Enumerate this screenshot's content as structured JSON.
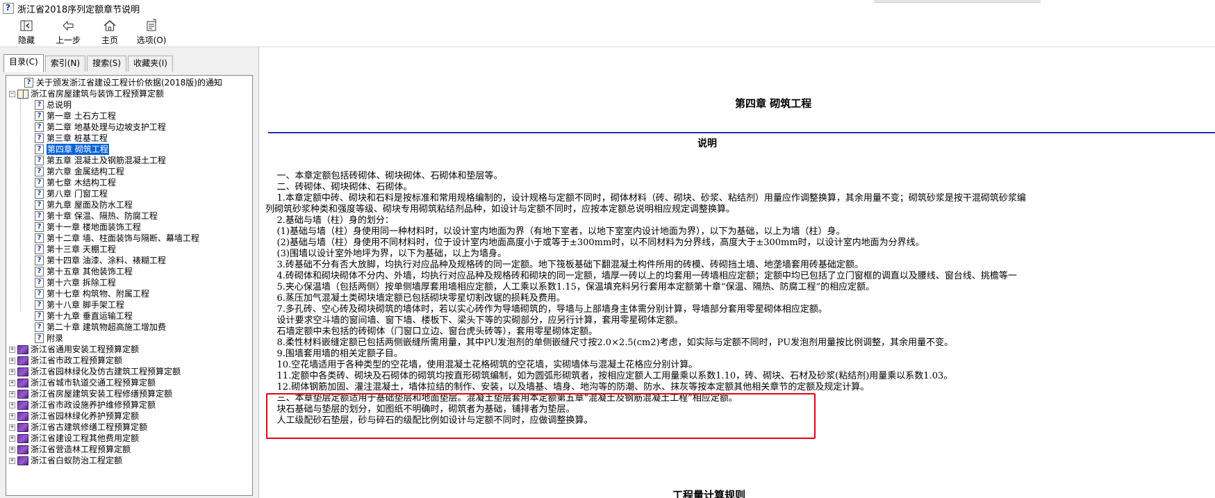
{
  "window": {
    "title": "浙江省2018序列定额章节说明"
  },
  "toolbar": {
    "hide": "隐藏",
    "back": "上一步",
    "home": "主页",
    "options": "选项(O)"
  },
  "tabs": [
    "目录(C)",
    "索引(N)",
    "搜索(S)",
    "收藏夹(I)"
  ],
  "tree": {
    "items": [
      {
        "label": "关于颁发浙江省建设工程计价依据(2018版)的通知",
        "level": 1,
        "icon": "question-icon"
      },
      {
        "label": "浙江省房屋建筑与装饰工程预算定额",
        "level": 0,
        "icon": "open-book-icon",
        "expander": "−"
      },
      {
        "label": "总说明",
        "level": 2,
        "icon": "question-icon"
      },
      {
        "label": "第一章 土石方工程",
        "level": 2,
        "icon": "question-icon"
      },
      {
        "label": "第二章 地基处理与边坡支护工程",
        "level": 2,
        "icon": "question-icon"
      },
      {
        "label": "第三章 桩基工程",
        "level": 2,
        "icon": "question-icon"
      },
      {
        "label": "第四章 砌筑工程",
        "level": 2,
        "icon": "question-icon",
        "selected": true
      },
      {
        "label": "第五章 混凝土及钢筋混凝土工程",
        "level": 2,
        "icon": "question-icon"
      },
      {
        "label": "第六章 金属结构工程",
        "level": 2,
        "icon": "question-icon"
      },
      {
        "label": "第七章 木结构工程",
        "level": 2,
        "icon": "question-icon"
      },
      {
        "label": "第八章 门窗工程",
        "level": 2,
        "icon": "question-icon"
      },
      {
        "label": "第九章 屋面及防水工程",
        "level": 2,
        "icon": "question-icon"
      },
      {
        "label": "第十章 保温、隔热、防腐工程",
        "level": 2,
        "icon": "question-icon"
      },
      {
        "label": "第十一章 楼地面装饰工程",
        "level": 2,
        "icon": "question-icon"
      },
      {
        "label": "第十二章 墙、柱面装饰与隔断、幕墙工程",
        "level": 2,
        "icon": "question-icon"
      },
      {
        "label": "第十三章 天棚工程",
        "level": 2,
        "icon": "question-icon"
      },
      {
        "label": "第十四章 油漆、涂料、裱糊工程",
        "level": 2,
        "icon": "question-icon"
      },
      {
        "label": "第十五章 其他装饰工程",
        "level": 2,
        "icon": "question-icon"
      },
      {
        "label": "第十六章 拆除工程",
        "level": 2,
        "icon": "question-icon"
      },
      {
        "label": "第十七章 构筑物、附属工程",
        "level": 2,
        "icon": "question-icon"
      },
      {
        "label": "第十八章 脚手架工程",
        "level": 2,
        "icon": "question-icon"
      },
      {
        "label": "第十九章 垂直运输工程",
        "level": 2,
        "icon": "question-icon"
      },
      {
        "label": "第二十章 建筑物超高施工增加费",
        "level": 2,
        "icon": "question-icon"
      },
      {
        "label": "附录",
        "level": 2,
        "icon": "question-icon"
      },
      {
        "label": "浙江省通用安装工程预算定额",
        "level": 0,
        "icon": "closed-book-icon",
        "expander": "+"
      },
      {
        "label": "浙江省市政工程预算定额",
        "level": 0,
        "icon": "closed-book-icon",
        "expander": "+"
      },
      {
        "label": "浙江省园林绿化及仿古建筑工程预算定额",
        "level": 0,
        "icon": "closed-book-icon",
        "expander": "+"
      },
      {
        "label": "浙江省城市轨道交通工程预算定额",
        "level": 0,
        "icon": "closed-book-icon",
        "expander": "+"
      },
      {
        "label": "浙江省房屋建筑安装工程修缮预算定额",
        "level": 0,
        "icon": "closed-book-icon",
        "expander": "+"
      },
      {
        "label": "浙江省市政设施养护维修预算定额",
        "level": 0,
        "icon": "closed-book-icon",
        "expander": "+"
      },
      {
        "label": "浙江省园林绿化养护预算定额",
        "level": 0,
        "icon": "closed-book-icon",
        "expander": "+"
      },
      {
        "label": "浙江省古建筑修缮工程预算定额",
        "level": 0,
        "icon": "closed-book-icon",
        "expander": "+"
      },
      {
        "label": "浙江省建设工程其他费用定额",
        "level": 0,
        "icon": "closed-book-icon",
        "expander": "+"
      },
      {
        "label": "浙江省营造林工程预算定额",
        "level": 0,
        "icon": "closed-book-icon",
        "expander": "+"
      },
      {
        "label": "浙江省白蚁防治工程定额",
        "level": 0,
        "icon": "closed-book-icon",
        "expander": "+"
      }
    ]
  },
  "content": {
    "chapter_title": "第四章  砌筑工程",
    "section_title": "说明",
    "lines": [
      "    一、本章定额包括砖砌体、砌块砌体、石砌体和垫层等。",
      "    二、砖砌体、砌块砌体、石砌体。",
      "    1.本章定额中砖、砌块和石料是按标准和常用规格编制的，设计规格与定额不同时，砌体材料（砖、砌块、砂浆、粘结剂）用量应作调整换算，其余用量不变；砌筑砂浆是按干混砌筑砂浆编",
      "列砌筑砂浆种类和强度等级、砌块专用砌筑粘结剂品种，如设计与定额不同时，应按本定额总说明相应规定调整换算。",
      "    2.基础与墙（柱）身的划分：",
      "    (1)基础与墙（柱）身使用同一种材料时，以设计室内地面为界（有地下室者，以地下室室内设计地面为界），以下为基础，以上为墙（柱）身。",
      "    (2)基础与墙（柱）身使用不同材料时，位于设计室内地面高度小于或等于±300mm时，以不同材料为分界线，高度大于±300mm时，以设计室内地面为分界线。",
      "    (3)围墙以设计室外地坪为界，以下为基础，以上为墙身。",
      "    3.砖基础不分有否大放脚，均执行对应品种及规格砖的同一定额。地下筏板基础下翻混凝土构件所用的砖模、砖砌挡土墙、地垄墙套用砖基础定额。",
      "    4.砖砌体和砌块砌体不分内、外墙，均执行对应品种及规格砖和砌块的同一定额，墙厚一砖以上的均套用一砖墙相应定额；定额中均已包括了立门窗框的调直以及腰线、窗台线、挑檐等一",
      "    5.夹心保温墙（包括两侧）按单侧墙厚套用墙相应定额，人工乘以系数1.15，保温填充料另行套用本定额第十章“保温、隔热、防腐工程”的相应定额。",
      "    6.蒸压加气混凝土类砌块墙定额已包括砌块零星切割改锯的损耗及费用。",
      "    7.多孔砖、空心砖及砌块砌筑的墙体时，若以实心砖作为导墙砌筑的，导墙与上部墙身主体需分别计算，导墙部分套用零星砌体相应定额。",
      "    设计要求空斗墙的窗间墙、窗下墙、楼板下、梁头下等的实砌部分，应另行计算，套用零星砌体定额。",
      "    石墙定额中未包括的砖砌体（门窗口立边、窗台虎头砖等），套用零星砌体定额。",
      "    8.柔性材料嵌缝定额已包括两侧嵌缝所需用量，其中PU发泡剂的单侧嵌缝尺寸按2.0×2.5(cm2)考虑，如实际与定额不同时，PU发泡剂用量按比例调整，其余用量不变。",
      "    9.围墙套用墙的相关定额子目。",
      "    10.空花墙适用于各种类型的空花墙，使用混凝土花格砌筑的空花墙，实砌墙体与混凝土花格应分别计算。",
      "    11.定额中各类砖、砌块及石砌体的砌筑均按直形砌筑编制，如为圆弧形砌筑者，按相应定额人工用量乘以系数1.10，砖、砌块、石材及砂浆(粘结剂)用量乘以系数1.03。",
      "    12.砌体钢筋加固、灌注混凝土，墙体拉结的制作、安装，以及墙基、墙身、地沟等的防潮、防水、抹灰等按本定额其他相关章节的定额及规定计算。",
      "    三、本章垫层定额适用于基础垫层和地面垫层。混凝土垫层套用本定额第五章“混凝土及钢筋混凝土工程”相应定额。",
      "    块石基础与垫层的划分，如图纸不明确时，砌筑者为基础，铺排者为垫层。",
      "    人工级配砂石垫层，砂与碎石的级配比例如设计与定额不同时，应做调整换算。"
    ],
    "next_heading": "工程量计算规则",
    "highlight_color": "#e60012",
    "rule_color": "#1f2fb0"
  }
}
